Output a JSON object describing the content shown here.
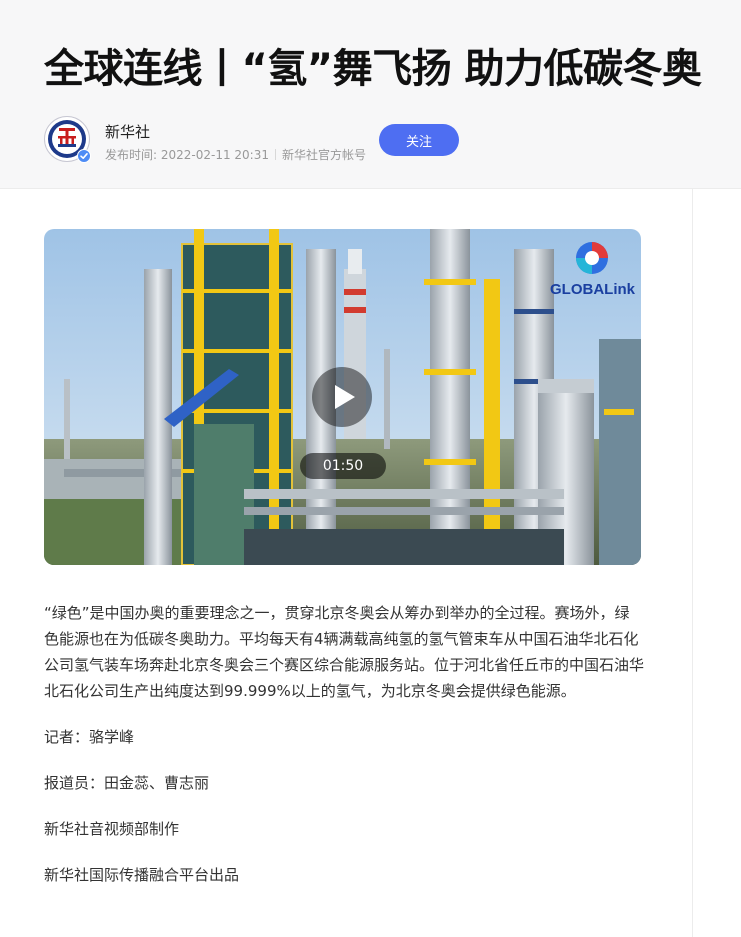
{
  "article": {
    "title": "全球连线丨“氢”舞飞扬 助力低碳冬奥",
    "author": {
      "name": "新华社",
      "avatar_icon": "xinhua-logo-icon",
      "verified_icon": "verified-badge-icon"
    },
    "meta": {
      "publish_label": "发布时间: 2022-02-11 20:31",
      "account_label": "新华社官方帐号"
    },
    "follow_label": "关注",
    "video": {
      "duration": "01:50",
      "brand_text": "GLOBALink",
      "play_icon": "play-icon"
    },
    "paragraphs": [
      "“绿色”是中国办奥的重要理念之一，贯穿北京冬奥会从筹办到举办的全过程。赛场外，绿色能源也在为低碳冬奥助力。平均每天有4辆满载高纯氢的氢气管束车从中国石油华北石化公司氢气装车场奔赴北京冬奥会三个赛区综合能源服务站。位于河北省任丘市的中国石油华北石化公司生产出纯度达到99.999%以上的氢气，为北京冬奥会提供绿色能源。",
      "记者：骆学峰",
      "报道员：田金蕊、曹志丽",
      "新华社音视频部制作",
      "新华社国际传播融合平台出品"
    ]
  },
  "colors": {
    "accent": "#4e6ef2",
    "header_bg": "#f7f7f8",
    "brand": "#1a3fa0"
  }
}
